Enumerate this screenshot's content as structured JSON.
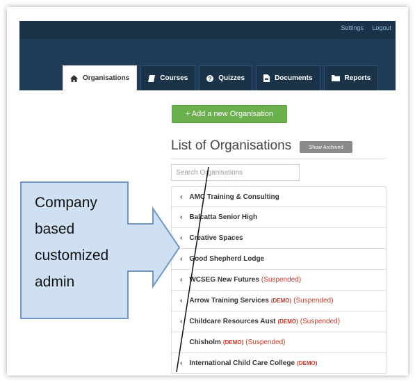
{
  "header": {
    "links": [
      "Settings",
      "Logout"
    ],
    "tabs": [
      {
        "label": "Organisations",
        "icon": "home-icon",
        "active": true
      },
      {
        "label": "Courses",
        "icon": "book-icon",
        "active": false
      },
      {
        "label": "Quizzes",
        "icon": "question-icon",
        "active": false
      },
      {
        "label": "Documents",
        "icon": "document-icon",
        "active": false
      },
      {
        "label": "Reports",
        "icon": "folder-icon",
        "active": false
      }
    ]
  },
  "main": {
    "add_button_label": "+ Add a new Organisation",
    "list_title": "List of Organisations",
    "show_archived_label": "Show Archived",
    "search_placeholder": "Search Organisations",
    "organisations": [
      {
        "name": "AMC Training & Consulting",
        "demo": "",
        "status": ""
      },
      {
        "name": "Balcatta Senior High",
        "demo": "",
        "status": ""
      },
      {
        "name": "Creative Spaces",
        "demo": "",
        "status": ""
      },
      {
        "name": "Good Shepherd Lodge",
        "demo": "",
        "status": ""
      },
      {
        "name": "WCSEG New Futures",
        "demo": "",
        "status": "(Suspended)"
      },
      {
        "name": "Arrow Training Services",
        "demo": "(DEMO)",
        "status": "(Suspended)"
      },
      {
        "name": "Childcare Resources Aust",
        "demo": "(DEMO)",
        "status": "(Suspended)"
      },
      {
        "name": "Chisholm",
        "demo": "(DEMO)",
        "status": "(Suspended)"
      },
      {
        "name": "International Child Care College",
        "demo": "(DEMO)",
        "status": ""
      }
    ]
  },
  "annotation": {
    "callout_lines": [
      "Company",
      "based",
      "customized",
      "admin"
    ]
  },
  "colors": {
    "nav_bg": "#1f3b57",
    "accent_green": "#6ab04c",
    "suspended_red": "#c0392b",
    "callout_fill": "#cfe0f3",
    "callout_stroke": "#6f96c4"
  }
}
